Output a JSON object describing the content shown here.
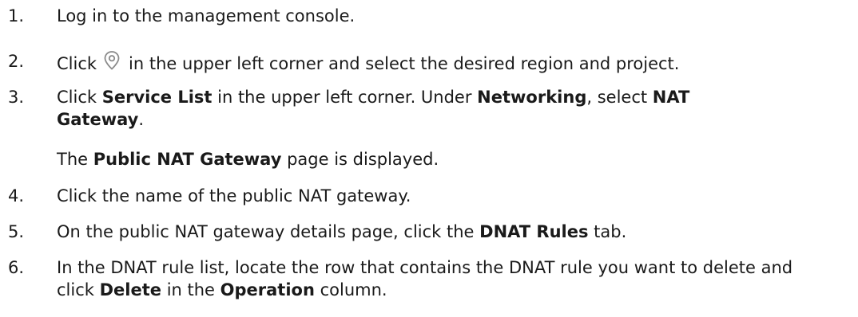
{
  "steps": [
    {
      "num": "1.",
      "parts": [
        {
          "t": "Log in to the management console."
        }
      ]
    },
    {
      "num": "2.",
      "parts": [
        {
          "t": "Click"
        },
        {
          "icon": "location-pin-icon"
        },
        {
          "t": "in the upper left corner and select the desired region and project."
        }
      ]
    },
    {
      "num": "3.",
      "parts": [
        {
          "t": "Click "
        },
        {
          "b": "Service List"
        },
        {
          "t": " in the upper left corner. Under "
        },
        {
          "b": "Networking"
        },
        {
          "t": ", select "
        },
        {
          "b": "NAT Gateway"
        },
        {
          "t": "."
        }
      ]
    },
    {
      "num": "",
      "parts": [
        {
          "t": "The "
        },
        {
          "b": "Public NAT Gateway"
        },
        {
          "t": " page is displayed."
        }
      ]
    },
    {
      "num": "4.",
      "parts": [
        {
          "t": "Click the name of the public NAT gateway."
        }
      ]
    },
    {
      "num": "5.",
      "parts": [
        {
          "t": "On the public NAT gateway details page, click the "
        },
        {
          "b": "DNAT Rules"
        },
        {
          "t": " tab."
        }
      ]
    },
    {
      "num": "6.",
      "parts": [
        {
          "t": "In the DNAT rule list, locate the row that contains the DNAT rule you want to delete and click "
        },
        {
          "b": "Delete"
        },
        {
          "t": " in the "
        },
        {
          "b": "Operation"
        },
        {
          "t": " column."
        }
      ]
    }
  ],
  "colors": {
    "text": "#1a1a1a",
    "icon": "#8a8a8a"
  }
}
